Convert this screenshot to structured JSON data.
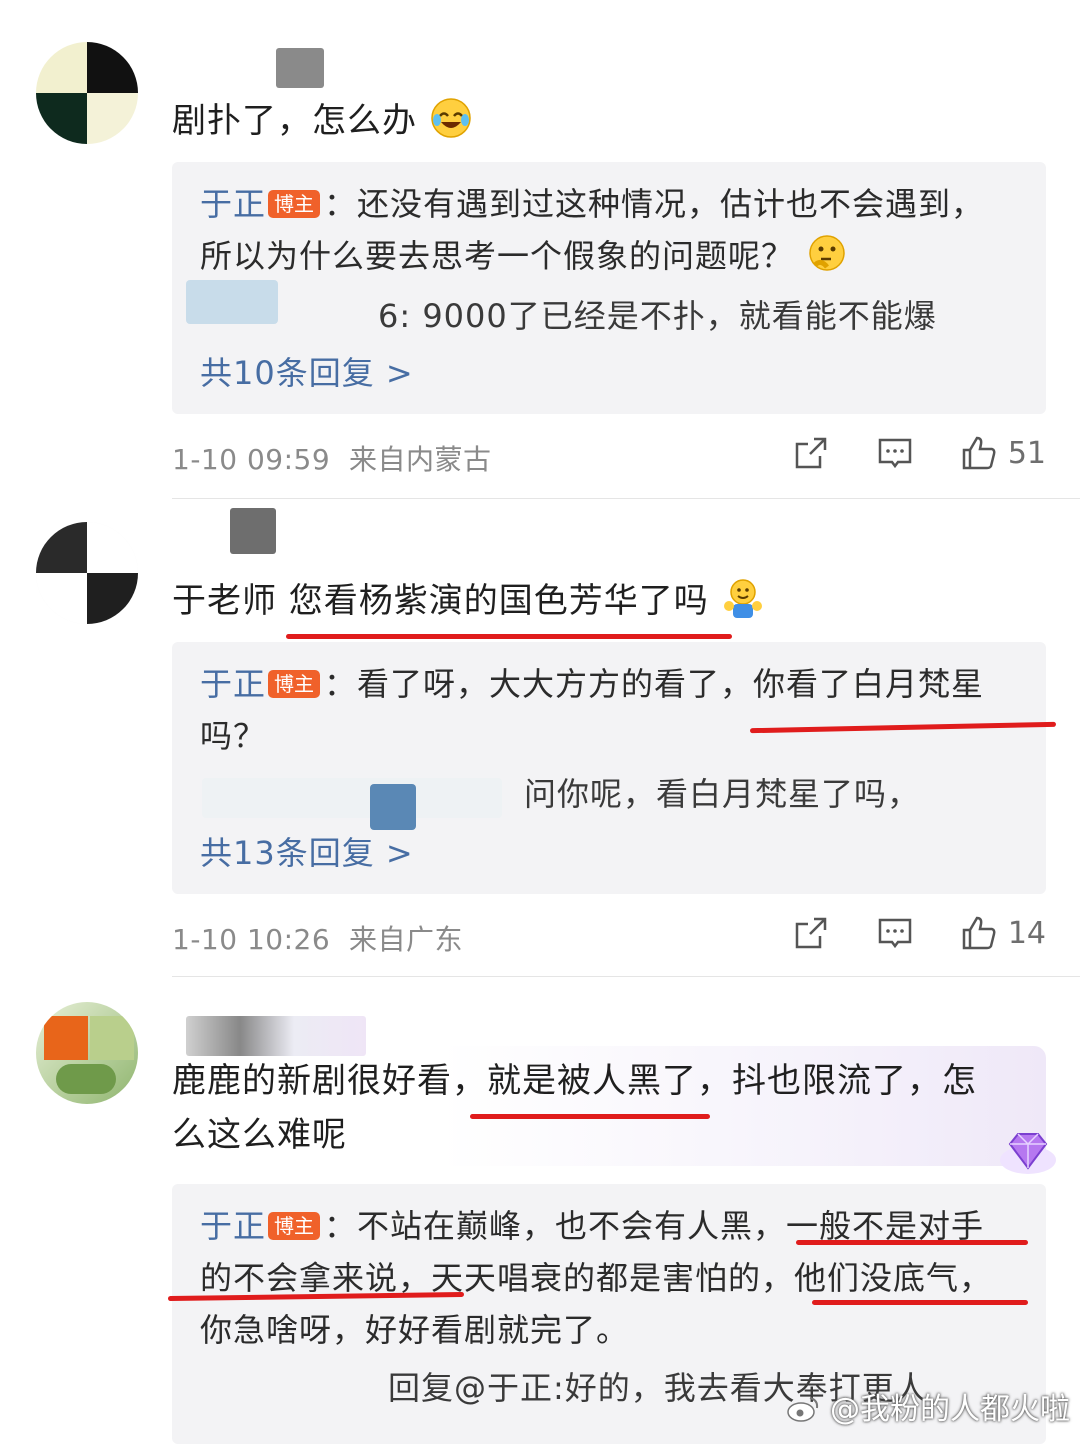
{
  "comments": [
    {
      "text": "剧扑了，怎么办",
      "reply": {
        "author": "于正",
        "badge": "博主",
        "text_line1": "：还没有遇到过这种情况，估计也不会遇到，",
        "text_line2": "所以为什么要去思考一个假象的问题呢？",
        "sub_reply": "6: 9000了已经是不扑，就看能不能爆",
        "more": "共10条回复 >"
      },
      "time": "1-10 09:59",
      "location": "来自内蒙古",
      "likes": "51"
    },
    {
      "text": "于老师 您看杨紫演的国色芳华了吗",
      "reply": {
        "author": "于正",
        "badge": "博主",
        "text_line1": "：看了呀，大大方方的看了，你看了白月梵星",
        "text_line2": "吗？",
        "sub_reply": "问你呢，看白月梵星了吗，",
        "more": "共13条回复 >"
      },
      "time": "1-10 10:26",
      "location": "来自广东",
      "likes": "14"
    },
    {
      "text_line1": "鹿鹿的新剧很好看，就是被人黑了，抖也限流了，怎",
      "text_line2": "么这么难呢",
      "reply": {
        "author": "于正",
        "badge": "博主",
        "text_line1": "：不站在巅峰，也不会有人黑，一般不是对手",
        "text_line2": "的不会拿来说，天天唱衰的都是害怕的，他们没底气，",
        "text_line3": "你急啥呀，好好看剧就完了。",
        "sub_reply": "回复@于正:好的，我去看大奉打更人"
      }
    }
  ],
  "watermark": "@我粉的人都火啦",
  "colors": {
    "author": "#476da3",
    "badge": "#f0612a",
    "underline": "#e01c1c",
    "meta": "#8a8a8a"
  },
  "icons": [
    "laughing-crying-emoji",
    "thinking-emoji",
    "hug-emoji",
    "share-icon",
    "comment-icon",
    "like-icon",
    "gem-icon",
    "weibo-logo-icon"
  ]
}
